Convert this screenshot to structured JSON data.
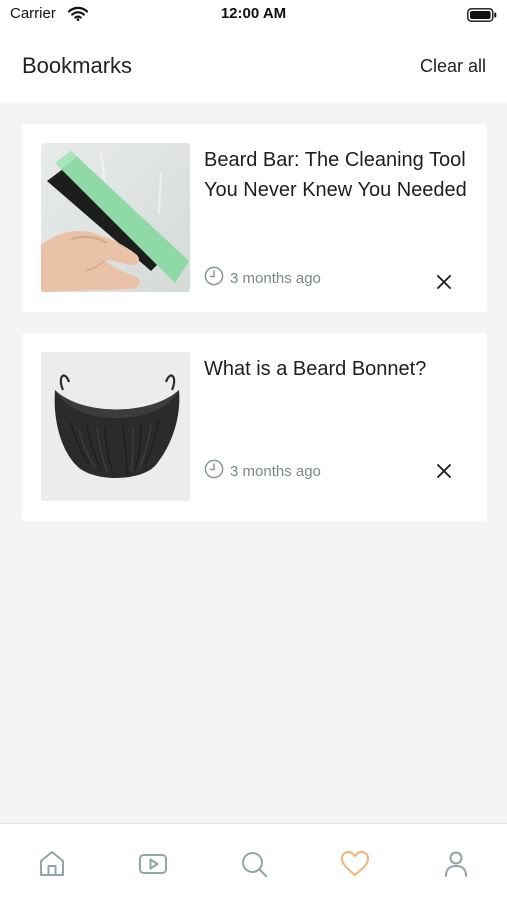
{
  "status_bar": {
    "carrier": "Carrier",
    "time": "12:00 AM"
  },
  "header": {
    "title": "Bookmarks",
    "clear_all_label": "Clear all"
  },
  "bookmarks": [
    {
      "title": "Beard Bar: The Cleaning Tool You Never Knew You Needed",
      "time_ago": "3 months ago",
      "thumbnail": "hand-holding-green-beard-bar"
    },
    {
      "title": "What is a Beard Bonnet?",
      "time_ago": "3 months ago",
      "thumbnail": "black-beard-bonnet"
    }
  ],
  "tabbar": {
    "items": [
      {
        "icon": "home-icon",
        "active": false
      },
      {
        "icon": "video-icon",
        "active": false
      },
      {
        "icon": "search-icon",
        "active": false
      },
      {
        "icon": "heart-icon",
        "active": true
      },
      {
        "icon": "profile-icon",
        "active": false
      }
    ],
    "active_color": "#f4b27a",
    "inactive_color": "#8fa5a6"
  },
  "colors": {
    "background": "#f4f4f4",
    "card": "#ffffff",
    "meta_text": "#7a8a86"
  }
}
